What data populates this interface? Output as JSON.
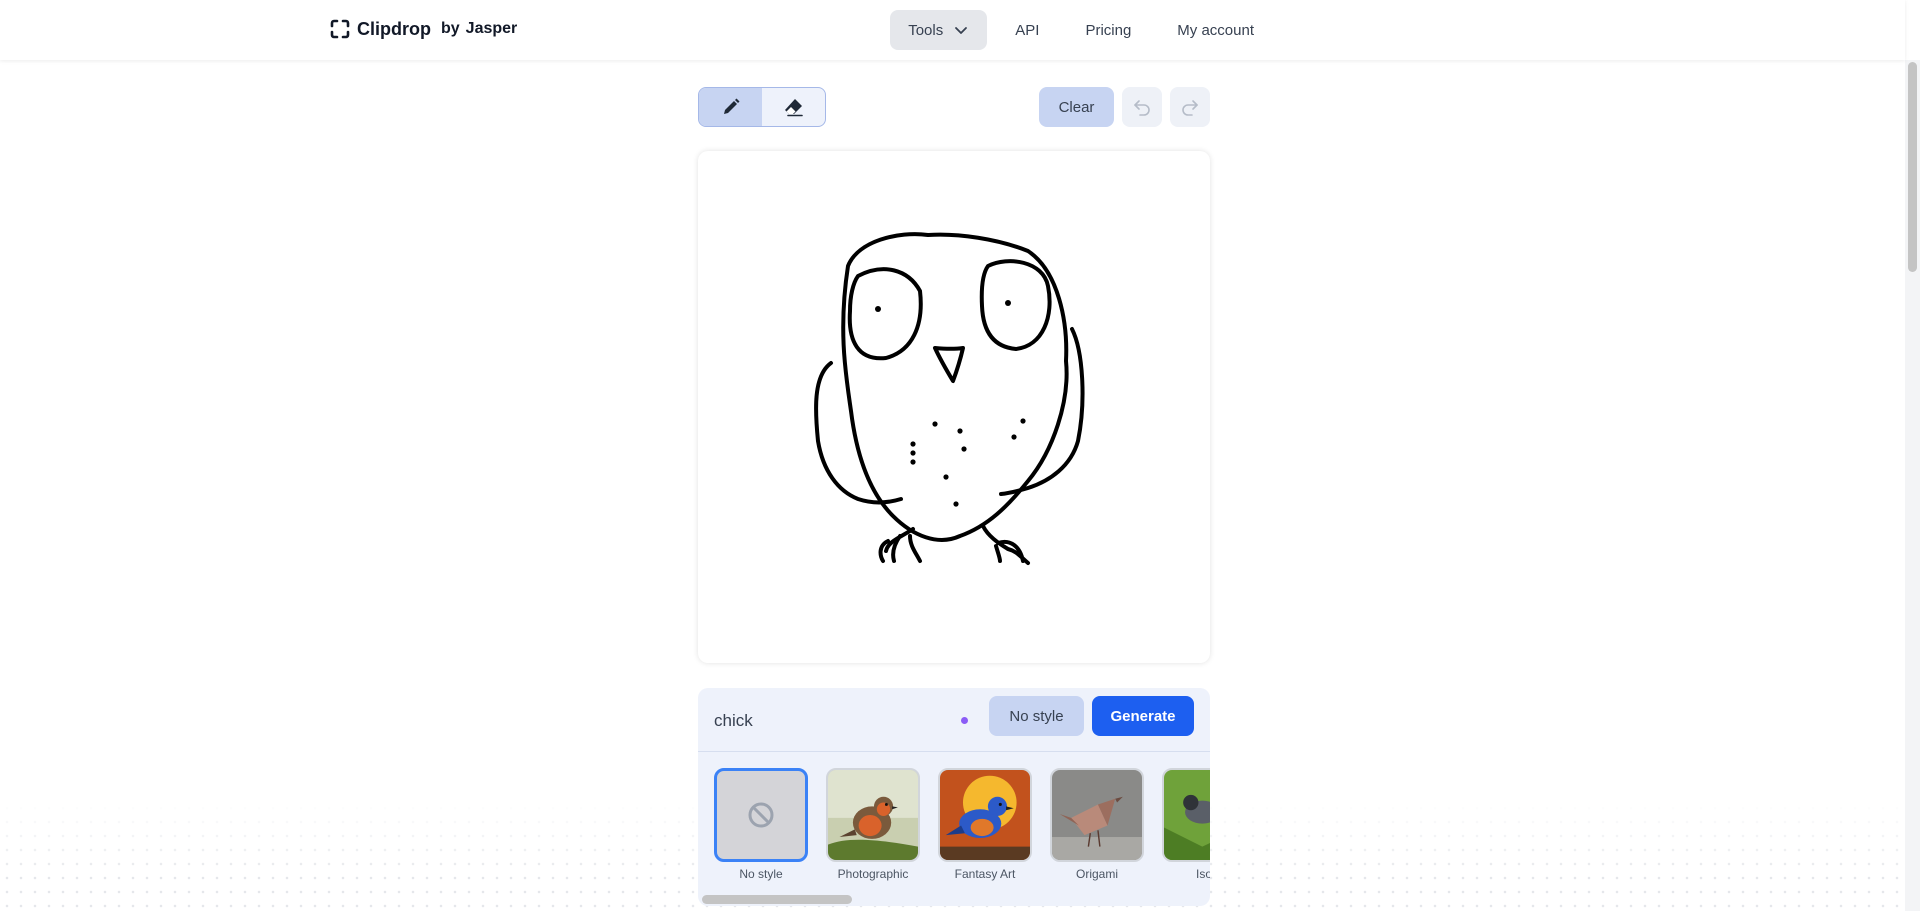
{
  "header": {
    "logo_text": "Clipdrop",
    "logo_by": "by",
    "logo_brand": "Jasper",
    "nav": {
      "tools": "Tools",
      "api": "API",
      "pricing": "Pricing",
      "account": "My account"
    }
  },
  "toolbar": {
    "pencil": "pencil-icon",
    "eraser": "eraser-icon",
    "clear_label": "Clear",
    "undo": "undo-icon",
    "redo": "redo-icon"
  },
  "prompt": {
    "value": "chick",
    "style_button": "No style",
    "generate_button": "Generate"
  },
  "styles": [
    {
      "label": "No style",
      "selected": true
    },
    {
      "label": "Photographic",
      "selected": false
    },
    {
      "label": "Fantasy Art",
      "selected": false
    },
    {
      "label": "Origami",
      "selected": false
    },
    {
      "label": "Isom",
      "selected": false
    }
  ],
  "colors": {
    "accent": "#1d5ff0",
    "status_dot": "#8b5cf6"
  }
}
